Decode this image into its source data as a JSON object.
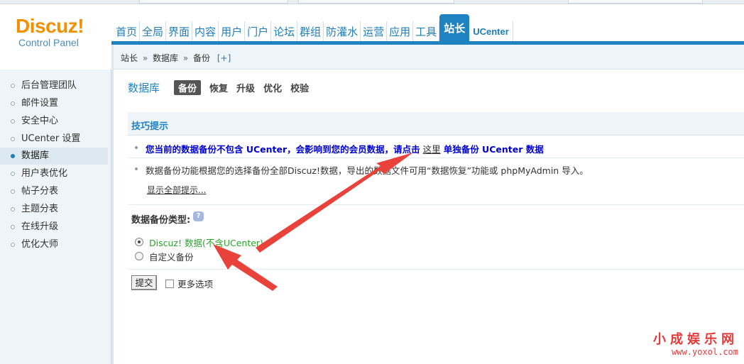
{
  "logo": {
    "title": "Discuz",
    "bang": "!",
    "subtitle": "Control Panel"
  },
  "nav": {
    "items": [
      "首页",
      "全局",
      "界面",
      "内容",
      "用户",
      "门户",
      "论坛",
      "群组",
      "防灌水",
      "运营",
      "应用",
      "工具"
    ],
    "active": "站长",
    "last": "UCenter"
  },
  "breadcrumb": {
    "parts": [
      "站长",
      "数据库",
      "备份"
    ],
    "sep": "»",
    "plus": "[+]"
  },
  "sidebar": {
    "items": [
      "后台管理团队",
      "邮件设置",
      "安全中心",
      "UCenter 设置",
      "数据库",
      "用户表优化",
      "帖子分表",
      "主题分表",
      "在线升级",
      "优化大师"
    ],
    "active_index": 4
  },
  "main": {
    "section": "数据库",
    "tabs": [
      "备份",
      "恢复",
      "升级",
      "优化",
      "校验"
    ],
    "active_tab": 0,
    "tips_title": "技巧提示",
    "tip1_before": "您当前的数据备份不包含 UCenter，会影响到您的会员数据，请点击",
    "tip1_link": "这里",
    "tip1_after": "单独备份 UCenter 数据",
    "tip2": "数据备份功能根据您的选择备份全部Discuz!数据，导出的数据文件可用“数据恢复”功能或 phpMyAdmin 导入。",
    "show_all": "显示全部提示...",
    "backup_type_label": "数据备份类型:",
    "help_icon_text": "?",
    "radio_discuz": "Discuz! 数据(不含UCenter)",
    "radio_custom": "自定义备份",
    "submit": "提交",
    "more_options": "更多选项"
  },
  "watermark": {
    "title": "小成娱乐网",
    "url": "www.yoxol.com"
  },
  "colors": {
    "accent": "#1f83c2",
    "arrow": "#e8423a",
    "logo": "#f29100",
    "green": "#2aa32a",
    "tip_blue": "#0000cc"
  }
}
